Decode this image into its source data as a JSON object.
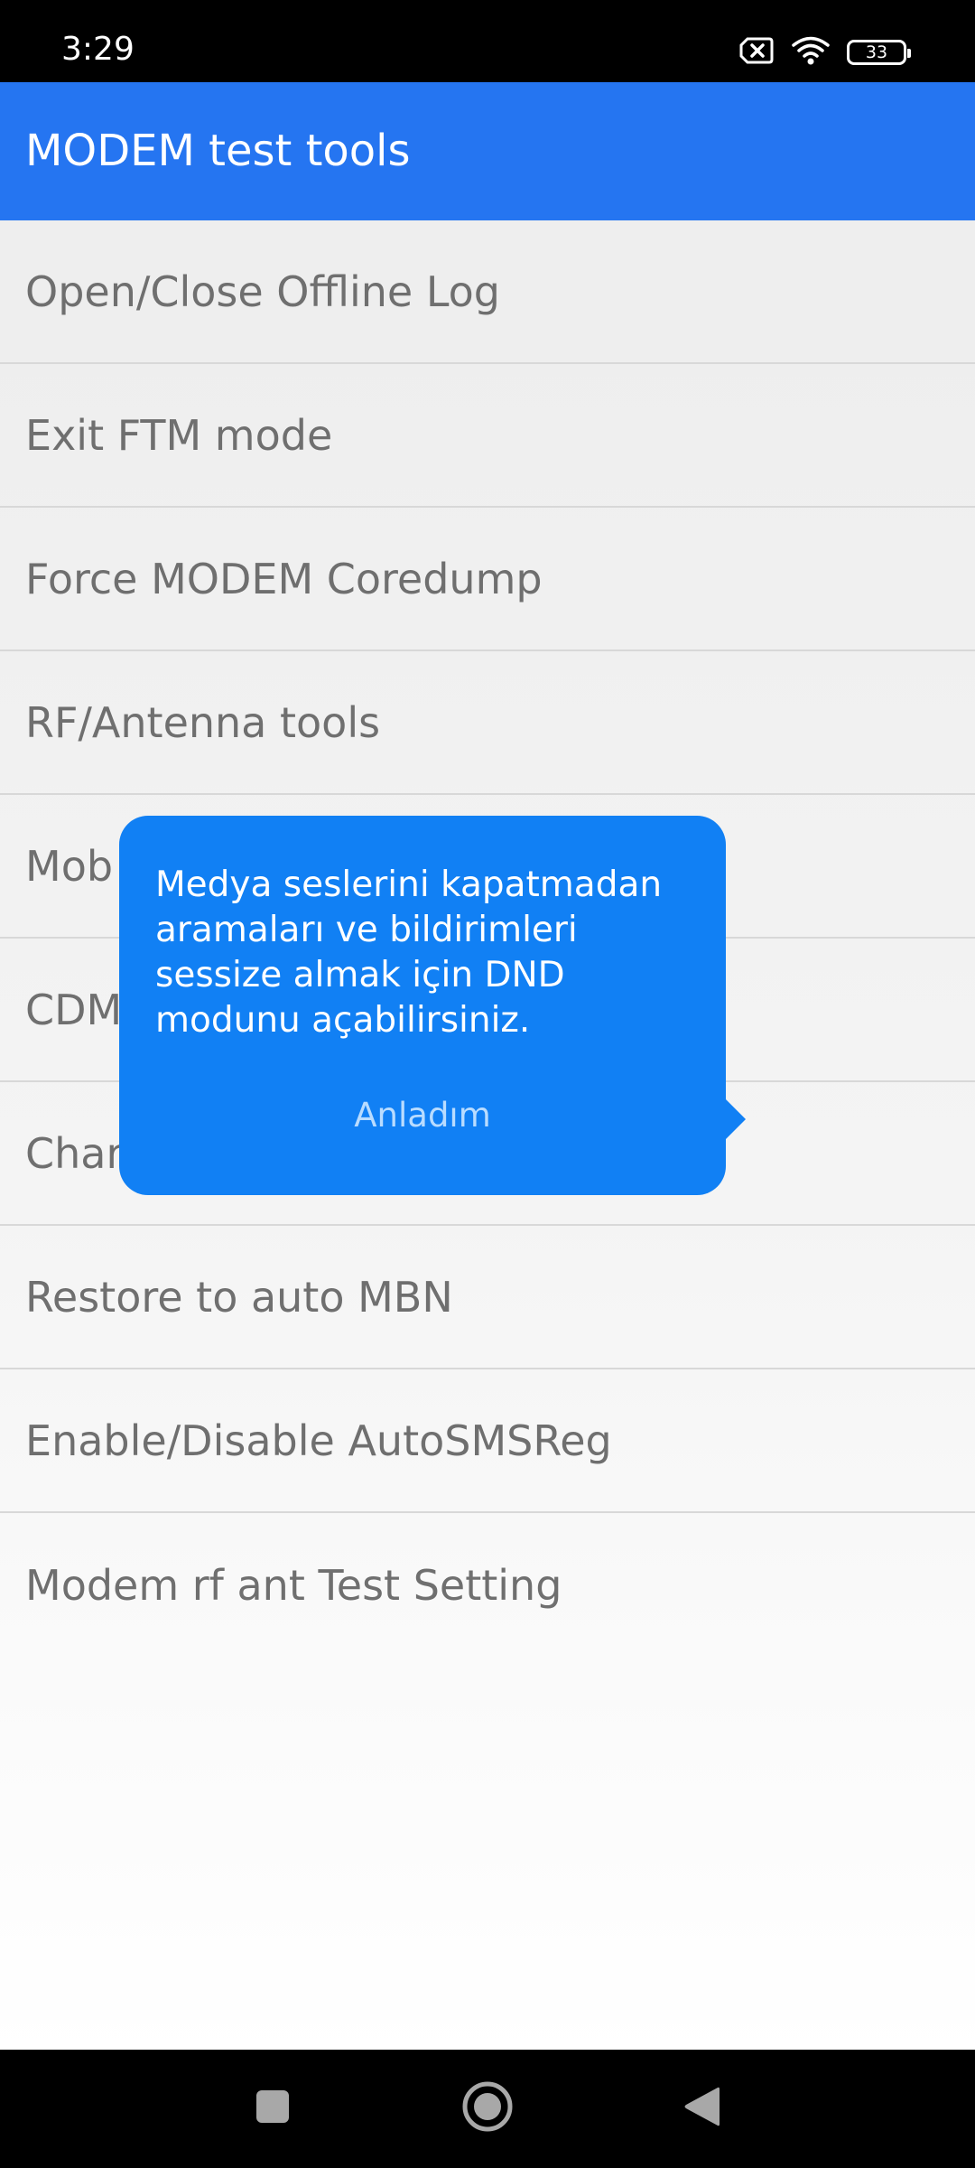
{
  "status_bar": {
    "time": "3:29",
    "battery": "33",
    "icons": [
      "sim-off-icon",
      "wifi-icon",
      "battery-icon"
    ]
  },
  "app_bar": {
    "title": "MODEM test tools",
    "color": "#2575f1"
  },
  "list": {
    "items": [
      {
        "label": "Open/Close Offline Log"
      },
      {
        "label": "Exit FTM mode"
      },
      {
        "label": "Force MODEM Coredump"
      },
      {
        "label": "RF/Antenna tools"
      },
      {
        "label": "Mob"
      },
      {
        "label": "CDM"
      },
      {
        "label": "Char"
      },
      {
        "label": "Restore to auto MBN"
      },
      {
        "label": "Enable/Disable AutoSMSReg"
      },
      {
        "label": "Modem rf ant Test Setting"
      }
    ]
  },
  "popup": {
    "message": "Medya seslerini kapatmadan aramaları ve bildirimleri sessize almak için DND modunu açabilirsiniz.",
    "button": "Anladım",
    "color": "#1180f4"
  },
  "nav_bar": {
    "icons": [
      "recents-icon",
      "home-icon",
      "back-icon"
    ]
  }
}
